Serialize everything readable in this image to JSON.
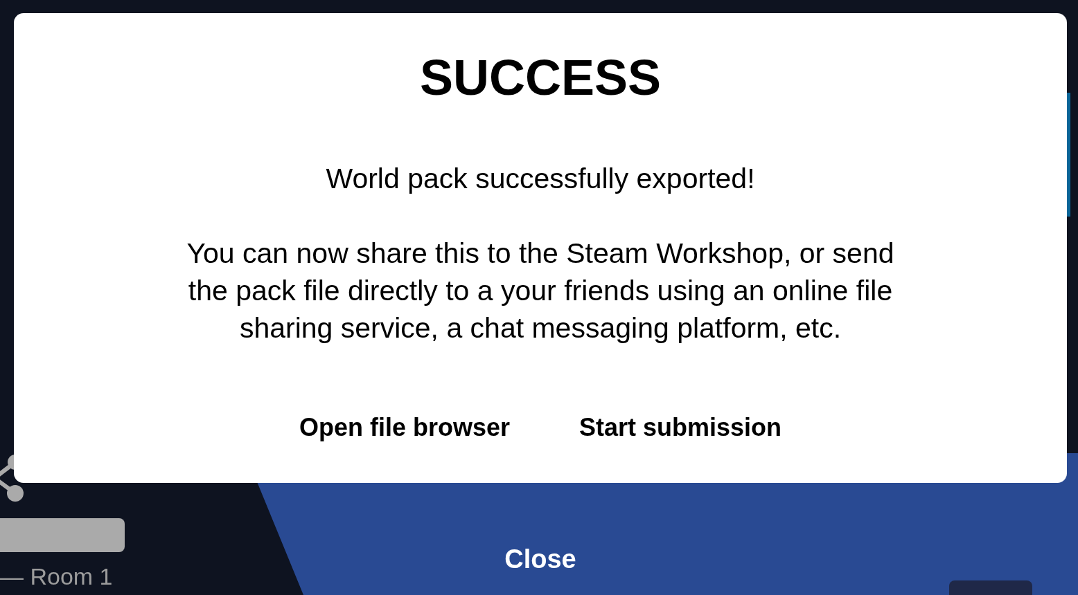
{
  "sidebar": {
    "room_label": "— Room 1"
  },
  "footer": {
    "close_button": "Close"
  },
  "dialog": {
    "title": "SUCCESS",
    "message": "World pack successfully exported!",
    "details": "You can now share this to the Steam Workshop, or send the pack file directly to a your friends using an online file sharing service, a chat messaging platform, etc.",
    "buttons": [
      "Open file browser",
      "Start submission"
    ]
  }
}
